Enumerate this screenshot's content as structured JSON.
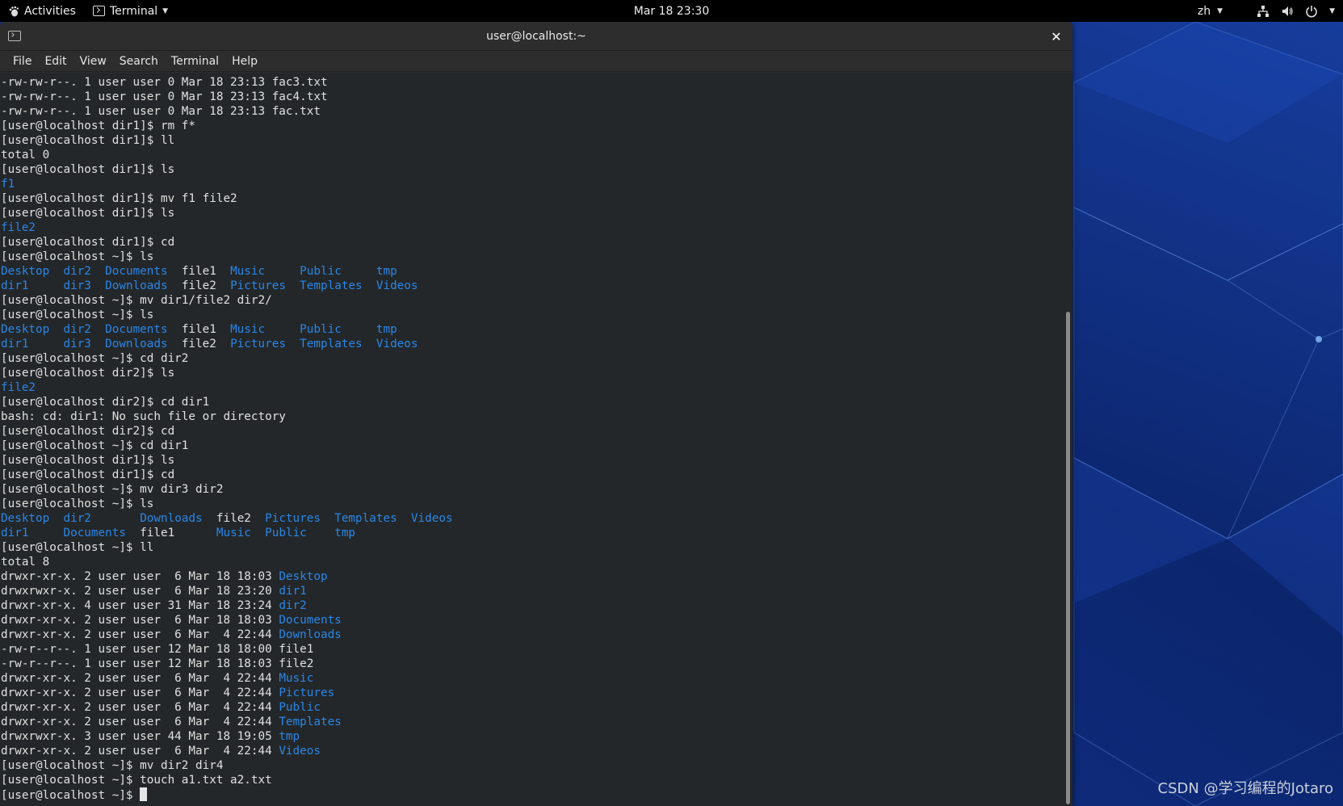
{
  "topbar": {
    "activities_label": "Activities",
    "app_menu_label": "Terminal",
    "clock": "Mar 18  23:30",
    "input_method": "zh"
  },
  "window": {
    "title": "user@localhost:~",
    "menu": [
      "File",
      "Edit",
      "View",
      "Search",
      "Terminal",
      "Help"
    ]
  },
  "colors": {
    "directory": "#2a86e8",
    "terminal_bg": "#232729",
    "text": "#e0e0e0"
  },
  "terminal_lines": [
    [
      {
        "t": "-rw-rw-r--. 1 user user 0 Mar 18 23:13 fac3.txt"
      }
    ],
    [
      {
        "t": "-rw-rw-r--. 1 user user 0 Mar 18 23:13 fac4.txt"
      }
    ],
    [
      {
        "t": "-rw-rw-r--. 1 user user 0 Mar 18 23:13 fac.txt"
      }
    ],
    [
      {
        "t": "[user@localhost dir1]$ rm f*"
      }
    ],
    [
      {
        "t": "[user@localhost dir1]$ ll"
      }
    ],
    [
      {
        "t": "total 0"
      }
    ],
    [
      {
        "t": "[user@localhost dir1]$ ls"
      }
    ],
    [
      {
        "t": "f1",
        "c": "blue"
      }
    ],
    [
      {
        "t": "[user@localhost dir1]$ mv f1 file2"
      }
    ],
    [
      {
        "t": "[user@localhost dir1]$ ls"
      }
    ],
    [
      {
        "t": "file2",
        "c": "blue"
      }
    ],
    [
      {
        "t": "[user@localhost dir1]$ cd"
      }
    ],
    [
      {
        "t": "[user@localhost ~]$ ls"
      }
    ],
    [
      {
        "t": "Desktop",
        "c": "blue"
      },
      {
        "t": "  "
      },
      {
        "t": "dir2",
        "c": "blue"
      },
      {
        "t": "  "
      },
      {
        "t": "Documents",
        "c": "blue"
      },
      {
        "t": "  file1  "
      },
      {
        "t": "Music",
        "c": "blue"
      },
      {
        "t": "     "
      },
      {
        "t": "Public",
        "c": "blue"
      },
      {
        "t": "     "
      },
      {
        "t": "tmp",
        "c": "blue"
      }
    ],
    [
      {
        "t": "dir1",
        "c": "blue"
      },
      {
        "t": "     "
      },
      {
        "t": "dir3",
        "c": "blue"
      },
      {
        "t": "  "
      },
      {
        "t": "Downloads",
        "c": "blue"
      },
      {
        "t": "  file2  "
      },
      {
        "t": "Pictures",
        "c": "blue"
      },
      {
        "t": "  "
      },
      {
        "t": "Templates",
        "c": "blue"
      },
      {
        "t": "  "
      },
      {
        "t": "Videos",
        "c": "blue"
      }
    ],
    [
      {
        "t": "[user@localhost ~]$ mv dir1/file2 dir2/"
      }
    ],
    [
      {
        "t": "[user@localhost ~]$ ls"
      }
    ],
    [
      {
        "t": "Desktop",
        "c": "blue"
      },
      {
        "t": "  "
      },
      {
        "t": "dir2",
        "c": "blue"
      },
      {
        "t": "  "
      },
      {
        "t": "Documents",
        "c": "blue"
      },
      {
        "t": "  file1  "
      },
      {
        "t": "Music",
        "c": "blue"
      },
      {
        "t": "     "
      },
      {
        "t": "Public",
        "c": "blue"
      },
      {
        "t": "     "
      },
      {
        "t": "tmp",
        "c": "blue"
      }
    ],
    [
      {
        "t": "dir1",
        "c": "blue"
      },
      {
        "t": "     "
      },
      {
        "t": "dir3",
        "c": "blue"
      },
      {
        "t": "  "
      },
      {
        "t": "Downloads",
        "c": "blue"
      },
      {
        "t": "  file2  "
      },
      {
        "t": "Pictures",
        "c": "blue"
      },
      {
        "t": "  "
      },
      {
        "t": "Templates",
        "c": "blue"
      },
      {
        "t": "  "
      },
      {
        "t": "Videos",
        "c": "blue"
      }
    ],
    [
      {
        "t": "[user@localhost ~]$ cd dir2"
      }
    ],
    [
      {
        "t": "[user@localhost dir2]$ ls"
      }
    ],
    [
      {
        "t": "file2",
        "c": "blue"
      }
    ],
    [
      {
        "t": "[user@localhost dir2]$ cd dir1"
      }
    ],
    [
      {
        "t": "bash: cd: dir1: No such file or directory"
      }
    ],
    [
      {
        "t": "[user@localhost dir2]$ cd"
      }
    ],
    [
      {
        "t": "[user@localhost ~]$ cd dir1"
      }
    ],
    [
      {
        "t": "[user@localhost dir1]$ ls"
      }
    ],
    [
      {
        "t": "[user@localhost dir1]$ cd"
      }
    ],
    [
      {
        "t": "[user@localhost ~]$ mv dir3 dir2"
      }
    ],
    [
      {
        "t": "[user@localhost ~]$ ls"
      }
    ],
    [
      {
        "t": "Desktop",
        "c": "blue"
      },
      {
        "t": "  "
      },
      {
        "t": "dir2",
        "c": "blue"
      },
      {
        "t": "       "
      },
      {
        "t": "Downloads",
        "c": "blue"
      },
      {
        "t": "  file2  "
      },
      {
        "t": "Pictures",
        "c": "blue"
      },
      {
        "t": "  "
      },
      {
        "t": "Templates",
        "c": "blue"
      },
      {
        "t": "  "
      },
      {
        "t": "Videos",
        "c": "blue"
      }
    ],
    [
      {
        "t": "dir1",
        "c": "blue"
      },
      {
        "t": "     "
      },
      {
        "t": "Documents",
        "c": "blue"
      },
      {
        "t": "  file1      "
      },
      {
        "t": "Music",
        "c": "blue"
      },
      {
        "t": "  "
      },
      {
        "t": "Public",
        "c": "blue"
      },
      {
        "t": "    "
      },
      {
        "t": "tmp",
        "c": "blue"
      }
    ],
    [
      {
        "t": "[user@localhost ~]$ ll"
      }
    ],
    [
      {
        "t": "total 8"
      }
    ],
    [
      {
        "t": "drwxr-xr-x. 2 user user  6 Mar 18 18:03 "
      },
      {
        "t": "Desktop",
        "c": "blue"
      }
    ],
    [
      {
        "t": "drwxrwxr-x. 2 user user  6 Mar 18 23:20 "
      },
      {
        "t": "dir1",
        "c": "blue"
      }
    ],
    [
      {
        "t": "drwxr-xr-x. 4 user user 31 Mar 18 23:24 "
      },
      {
        "t": "dir2",
        "c": "blue"
      }
    ],
    [
      {
        "t": "drwxr-xr-x. 2 user user  6 Mar 18 18:03 "
      },
      {
        "t": "Documents",
        "c": "blue"
      }
    ],
    [
      {
        "t": "drwxr-xr-x. 2 user user  6 Mar  4 22:44 "
      },
      {
        "t": "Downloads",
        "c": "blue"
      }
    ],
    [
      {
        "t": "-rw-r--r--. 1 user user 12 Mar 18 18:00 file1"
      }
    ],
    [
      {
        "t": "-rw-r--r--. 1 user user 12 Mar 18 18:03 file2"
      }
    ],
    [
      {
        "t": "drwxr-xr-x. 2 user user  6 Mar  4 22:44 "
      },
      {
        "t": "Music",
        "c": "blue"
      }
    ],
    [
      {
        "t": "drwxr-xr-x. 2 user user  6 Mar  4 22:44 "
      },
      {
        "t": "Pictures",
        "c": "blue"
      }
    ],
    [
      {
        "t": "drwxr-xr-x. 2 user user  6 Mar  4 22:44 "
      },
      {
        "t": "Public",
        "c": "blue"
      }
    ],
    [
      {
        "t": "drwxr-xr-x. 2 user user  6 Mar  4 22:44 "
      },
      {
        "t": "Templates",
        "c": "blue"
      }
    ],
    [
      {
        "t": "drwxrwxr-x. 3 user user 44 Mar 18 19:05 "
      },
      {
        "t": "tmp",
        "c": "blue"
      }
    ],
    [
      {
        "t": "drwxr-xr-x. 2 user user  6 Mar  4 22:44 "
      },
      {
        "t": "Videos",
        "c": "blue"
      }
    ],
    [
      {
        "t": "[user@localhost ~]$ mv dir2 dir4"
      }
    ],
    [
      {
        "t": "[user@localhost ~]$ touch a1.txt a2.txt"
      }
    ],
    [
      {
        "t": "[user@localhost ~]$ "
      },
      {
        "cursor": true
      }
    ]
  ],
  "watermark": "CSDN @学习编程的Jotaro"
}
